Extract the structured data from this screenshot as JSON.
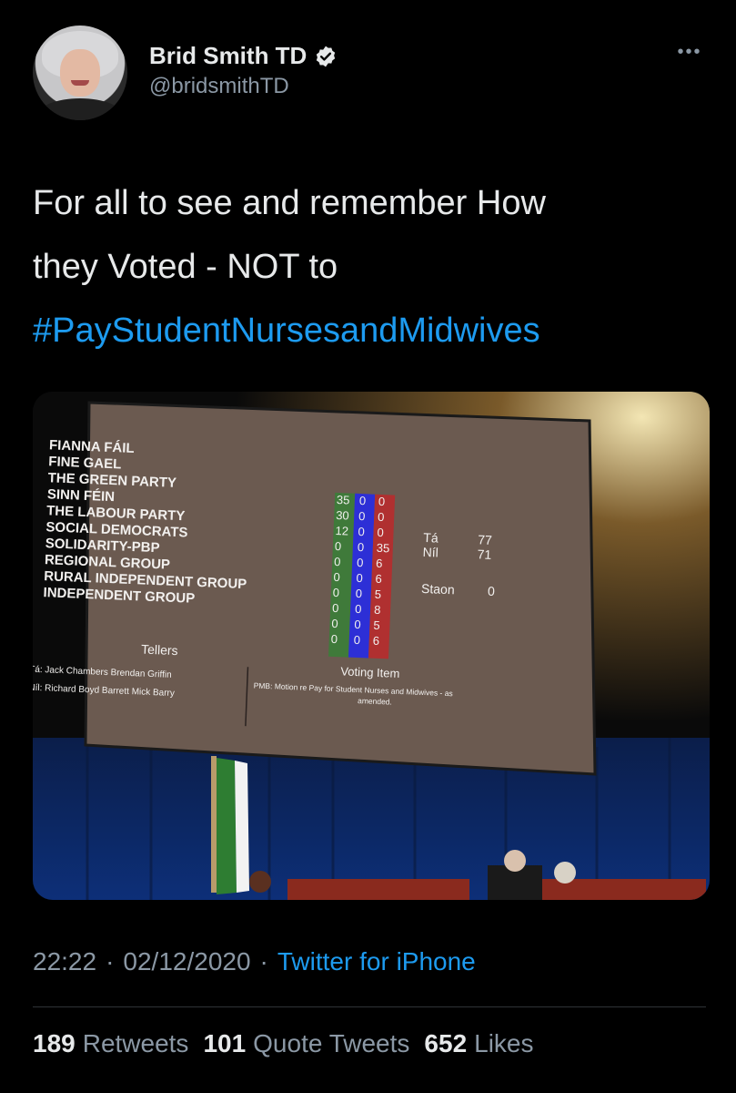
{
  "author": {
    "display_name": "Brid Smith TD",
    "handle": "@bridsmithTD",
    "verified_icon": "verified-badge-icon",
    "more_icon": "more-options-icon"
  },
  "tweet": {
    "text_line1": "For all to see and remember How",
    "text_line2": "they Voted - NOT to",
    "hashtag": "#PayStudentNursesandMidwives"
  },
  "screen": {
    "parties": [
      "FIANNA FÁIL",
      "FINE GAEL",
      "THE GREEN PARTY",
      "SINN FÉIN",
      "THE LABOUR PARTY",
      "SOCIAL DEMOCRATS",
      "SOLIDARITY-PBP",
      "REGIONAL GROUP",
      "RURAL INDEPENDENT GROUP",
      "INDEPENDENT GROUP"
    ],
    "ta_votes": [
      "35",
      "30",
      "12",
      "0",
      "0",
      "0",
      "0",
      "0",
      "0",
      "0"
    ],
    "staon_votes": [
      "0",
      "0",
      "0",
      "0",
      "0",
      "0",
      "0",
      "0",
      "0",
      "0"
    ],
    "nil_votes": [
      "0",
      "0",
      "0",
      "35",
      "6",
      "6",
      "5",
      "8",
      "5",
      "6"
    ],
    "totals": {
      "ta_label": "Tá",
      "ta_value": "77",
      "nil_label": "Níl",
      "nil_value": "71",
      "staon_label": "Staon",
      "staon_value": "0"
    },
    "tellers_heading": "Tellers",
    "tellers_ta": "Tá: Jack Chambers  Brendan Griffin",
    "tellers_nil": "Níl: Richard Boyd Barrett  Mick Barry",
    "voting_item_heading": "Voting Item",
    "voting_item_line1": "PMB: Motion re Pay for Student Nurses and Midwives - as",
    "voting_item_line2": "amended."
  },
  "meta": {
    "time": "22:22",
    "date": "02/12/2020",
    "separator": "·",
    "source": "Twitter for iPhone"
  },
  "stats": {
    "retweets_count": "189",
    "retweets_label": "Retweets",
    "quotes_count": "101",
    "quotes_label": "Quote Tweets",
    "likes_count": "652",
    "likes_label": "Likes"
  },
  "colors": {
    "background": "#000000",
    "link": "#1d9bf0",
    "secondary_text": "#8b98a5",
    "ta_column": "#3f7a3a",
    "staon_column": "#2d2fd6",
    "nil_column": "#b03030"
  }
}
